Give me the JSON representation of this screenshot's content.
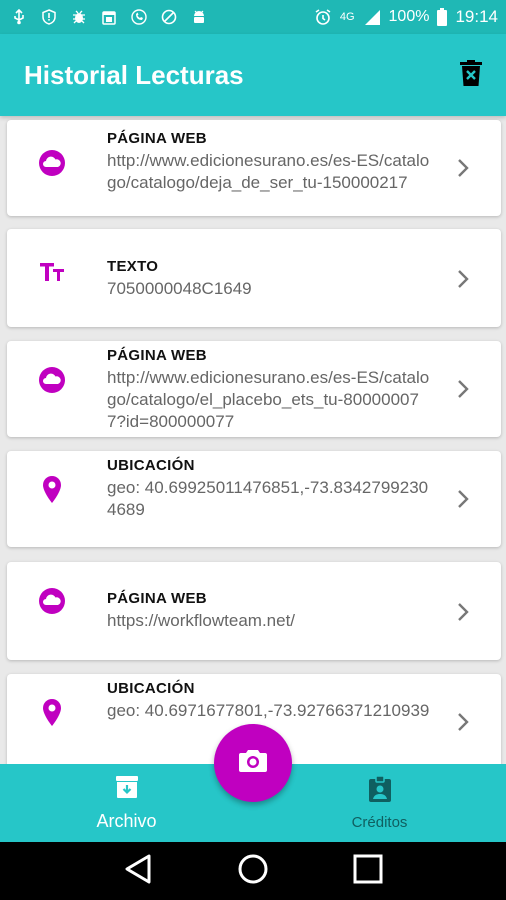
{
  "status_bar": {
    "battery_percent": "100%",
    "time": "19:14",
    "network": "4G",
    "left_icons": [
      "usb-icon",
      "alert-icon",
      "bug-icon",
      "calendar-icon",
      "phone-icon",
      "block-icon",
      "android-icon"
    ],
    "right_icons": [
      "alarm-icon",
      "network-4g-icon",
      "signal-icon",
      "battery-icon"
    ]
  },
  "app_bar": {
    "title": "Historial Lecturas",
    "action_icon": "delete-all-icon"
  },
  "colors": {
    "accent": "#c000c0",
    "primary": "#26c6c8",
    "status_bar": "#1fb8b5"
  },
  "history": [
    {
      "type": "web",
      "icon": "cloud-icon",
      "title": "PÁGINA WEB",
      "value": "http://www.edicionesurano.es/es-ES/catalogo/catalogo/deja_de_ser_tu-150000217"
    },
    {
      "type": "text",
      "icon": "text-format-icon",
      "title": "TEXTO",
      "value": "7050000048C1649"
    },
    {
      "type": "web",
      "icon": "cloud-icon",
      "title": "PÁGINA WEB",
      "value": "http://www.edicionesurano.es/es-ES/catalogo/catalogo/el_placebo_ets_tu-800000077?id=800000077"
    },
    {
      "type": "location",
      "icon": "location-pin-icon",
      "title": "UBICACIÓN",
      "value": "geo: 40.69925011476851,-73.83427992304689"
    },
    {
      "type": "web",
      "icon": "cloud-icon",
      "title": "PÁGINA WEB",
      "value": "https://workflowteam.net/"
    },
    {
      "type": "location",
      "icon": "location-pin-icon",
      "title": "UBICACIÓN",
      "value": "geo: 40.6971677801,-73.92766371210939"
    }
  ],
  "bottom_nav": {
    "items": [
      {
        "label": "Archivo",
        "icon": "archive-icon",
        "active": true
      },
      {
        "label": "Créditos",
        "icon": "badge-icon",
        "active": false
      }
    ],
    "fab_icon": "camera-icon"
  },
  "system_nav": {
    "icons": [
      "back-icon",
      "home-icon",
      "recents-icon"
    ]
  }
}
